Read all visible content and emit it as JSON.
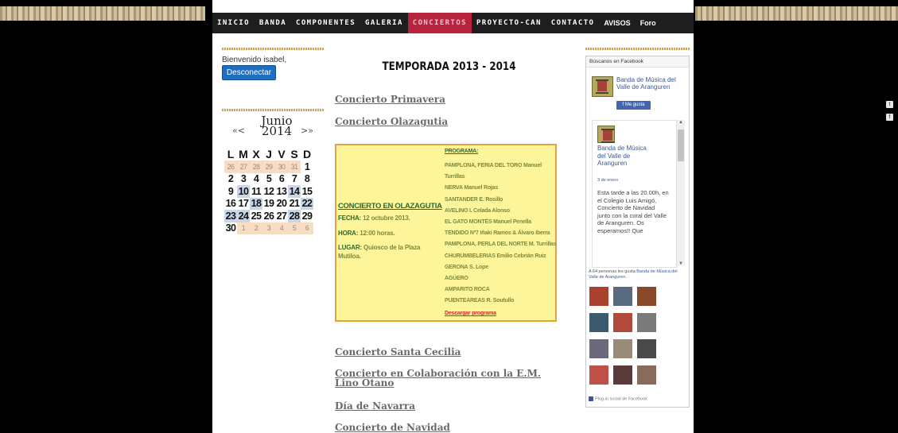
{
  "nav": [
    "INICIO",
    "BANDA",
    "COMPONENTES",
    "GALERIA",
    "CONCIERTOS",
    "PROYECTO-CAN",
    "CONTACTO",
    "AVISOS",
    "Foro"
  ],
  "user": {
    "welcome": "Bienvenido isabel,",
    "logout": "Desconectar"
  },
  "calendar": {
    "month": "Junio",
    "year": "2014",
    "prev": "«<",
    "next": ">»",
    "days": [
      "L",
      "M",
      "X",
      "J",
      "V",
      "S",
      "D"
    ],
    "rows": [
      [
        "26",
        "27",
        "28",
        "29",
        "30",
        "31",
        "1"
      ],
      [
        "2",
        "3",
        "4",
        "5",
        "6",
        "7",
        "8"
      ],
      [
        "9",
        "10",
        "11",
        "12",
        "13",
        "14",
        "15"
      ],
      [
        "16",
        "17",
        "18",
        "19",
        "20",
        "21",
        "22"
      ],
      [
        "23",
        "24",
        "25",
        "26",
        "27",
        "28",
        "29"
      ],
      [
        "30",
        "1",
        "2",
        "3",
        "4",
        "5",
        "6"
      ]
    ]
  },
  "main": {
    "title": "TEMPORADA 2013 - 2014",
    "links": [
      "Concierto Primavera",
      "Concierto Olazagutia",
      "Concierto Santa Cecilia",
      "Concierto en Colaboración con la E.M. Lino Otano",
      "Día de Navarra",
      "Concierto de Navidad"
    ],
    "box": {
      "title": "CONCIERTO EN OLAZAGUTIA",
      "fecha_label": "FECHA:",
      "fecha": "12 octubre 2013.",
      "hora_label": "HORA:",
      "hora": "12:00 horas.",
      "lugar_label": "LUGAR:",
      "lugar": "Quiosco de la Plaza Mutiloa.",
      "programa_label": "PROGRAMA:",
      "programa": [
        "PAMPLONA, FERIA DEL TORO Manuel",
        "Turrillas",
        "NERVA Manuel Rojas",
        "SANTANDER E. Rosillo",
        "AVELINO I. Celada Alonso",
        "EL GATO MONTÉS Manuel Penella",
        "TENDIDO Nº7 Iñaki Ramos & Álvaro Iberra",
        "PAMPLONA, PERLA DEL NORTE M. Turrillas",
        "CHURUMBELERIAS Emilio Cebrián Ruiz",
        "GERONA S. Lope",
        "AGÜERO",
        "AMPARITO ROCA",
        "PUENTEAREAS R. Soutullo"
      ],
      "download": "Descargar programa"
    }
  },
  "facebook": {
    "header": "Búscanos en Facebook",
    "page_name": "Banda de Música del Valle de Aranguren",
    "like": "Me gusta",
    "post_name": "Banda de Música del Valle de Aranguren",
    "post_date": "3 de enero",
    "post_text": "Esta tarde a las 20.00h, en el Colegio Luis Amigó, Concierto de Navidad junto con la coral del Valle de Aranguren. Os esperamos!! Que",
    "count_pre": "A 64 personas les gusta",
    "count_link": "Banda de Música del Valle de Aranguren.",
    "footer": "Plug-in social de Facebook",
    "face_colors": [
      "#a8412e",
      "#5a6a80",
      "#8a4a2a",
      "#3a5a70",
      "#b04a3a",
      "#7a7a7a",
      "#6a6a7a",
      "#9a8a7a",
      "#4a4a4a",
      "#c0504a",
      "#5a3a3a",
      "#8a6a5a"
    ]
  },
  "social": {
    "tumblr": "t",
    "facebook": "f"
  }
}
